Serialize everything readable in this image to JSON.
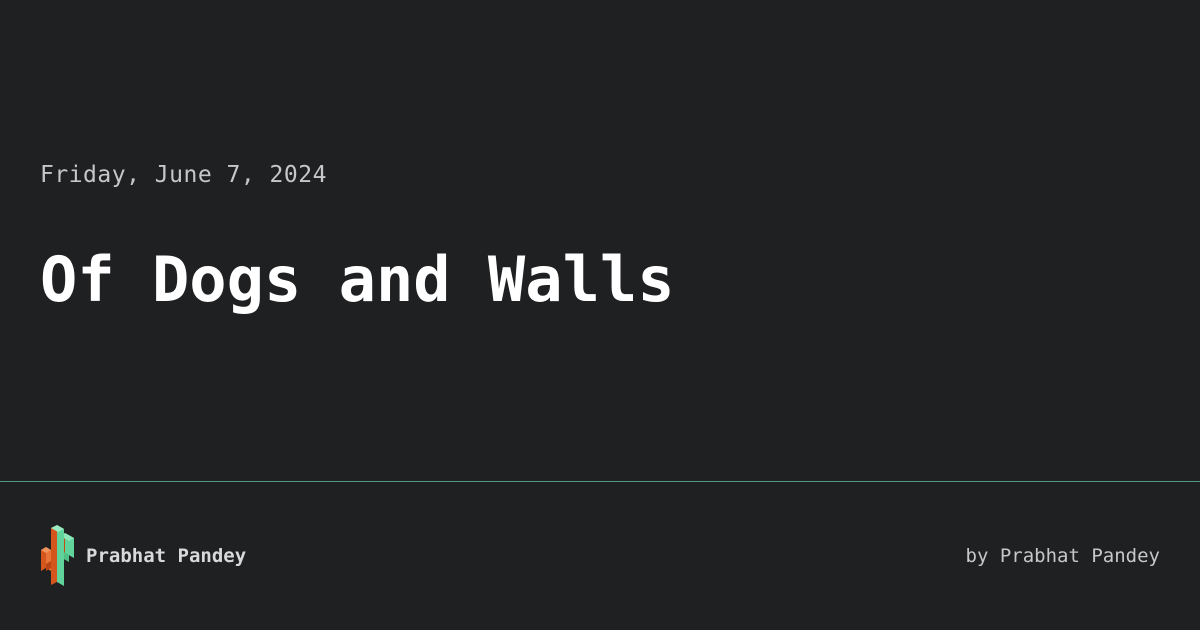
{
  "post": {
    "date": "Friday, June 7, 2024",
    "title": "Of Dogs and Walls"
  },
  "footer": {
    "logo_icon": "cactus-logo-icon",
    "site_name": "Prabhat Pandey",
    "byline": "by Prabhat Pandey"
  },
  "colors": {
    "background": "#1f2022",
    "divider": "#4a9b82",
    "logo_green": "#5fd39a",
    "logo_orange": "#d4561c"
  }
}
